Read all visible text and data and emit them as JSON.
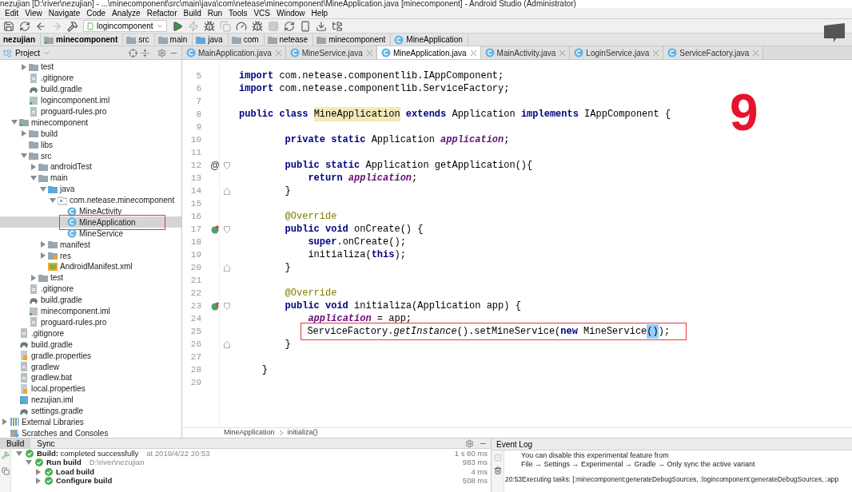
{
  "window": {
    "title": "nezujian [D:\\river\\nezujian] - ...\\minecomponent\\src\\main\\java\\com\\netease\\minecomponent\\MineApplication.java [minecomponent] - Android Studio (Administrator)"
  },
  "menu": [
    "Edit",
    "View",
    "Navigate",
    "Code",
    "Analyze",
    "Refactor",
    "Build",
    "Run",
    "Tools",
    "VCS",
    "Window",
    "Help"
  ],
  "toolbar": {
    "run_config": "logincomponent"
  },
  "breadcrumb": [
    {
      "label": "nezujian",
      "kind": "project"
    },
    {
      "label": "minecomponent",
      "kind": "module"
    },
    {
      "label": "src",
      "kind": "folder"
    },
    {
      "label": "main",
      "kind": "folder"
    },
    {
      "label": "java",
      "kind": "source"
    },
    {
      "label": "com",
      "kind": "folder"
    },
    {
      "label": "netease",
      "kind": "folder"
    },
    {
      "label": "minecomponent",
      "kind": "folder"
    },
    {
      "label": "MineApplication",
      "kind": "class"
    }
  ],
  "project_panel": {
    "title": "Project",
    "tree": {
      "continued": [
        {
          "label": "test",
          "kind": "folder",
          "expanded": false,
          "selected": false,
          "outlined": false
        },
        {
          "label": ".gitignore",
          "kind": "file",
          "selected": false,
          "outlined": false
        },
        {
          "label": "build.gradle",
          "kind": "gradle",
          "selected": false,
          "outlined": false
        },
        {
          "label": "logincomponent.iml",
          "kind": "iml",
          "selected": false,
          "outlined": false
        },
        {
          "label": "proguard-rules.pro",
          "kind": "file",
          "selected": false,
          "outlined": false
        }
      ],
      "items": [
        {
          "label": "minecomponent",
          "kind": "module",
          "expanded": true,
          "selected": false,
          "outlined": false,
          "children": [
            {
              "label": "build",
              "kind": "folder",
              "expanded": false,
              "selected": false,
              "outlined": false
            },
            {
              "label": "libs",
              "kind": "folder",
              "selected": false,
              "outlined": false
            },
            {
              "label": "src",
              "kind": "folder",
              "expanded": true,
              "selected": false,
              "outlined": false,
              "children": [
                {
                  "label": "androidTest",
                  "kind": "folder",
                  "expanded": false,
                  "selected": false,
                  "outlined": false
                },
                {
                  "label": "main",
                  "kind": "folder",
                  "expanded": true,
                  "selected": false,
                  "outlined": false,
                  "children": [
                    {
                      "label": "java",
                      "kind": "source",
                      "expanded": true,
                      "selected": false,
                      "outlined": false,
                      "children": [
                        {
                          "label": "com.netease.minecomponent",
                          "kind": "package",
                          "expanded": true,
                          "selected": false,
                          "outlined": false,
                          "children": [
                            {
                              "label": "MineActivity",
                              "kind": "class",
                              "selected": false,
                              "outlined": false
                            },
                            {
                              "label": "MineApplication",
                              "kind": "class",
                              "selected": true,
                              "outlined": true
                            },
                            {
                              "label": "MineService",
                              "kind": "class",
                              "selected": false,
                              "outlined": false
                            }
                          ]
                        }
                      ]
                    },
                    {
                      "label": "manifest",
                      "kind": "folder",
                      "expanded": false,
                      "selected": false,
                      "outlined": false
                    },
                    {
                      "label": "res",
                      "kind": "res",
                      "expanded": false,
                      "selected": false,
                      "outlined": false
                    },
                    {
                      "label": "AndroidManifest.xml",
                      "kind": "xml",
                      "selected": false,
                      "outlined": false
                    }
                  ]
                },
                {
                  "label": "test",
                  "kind": "folder",
                  "expanded": false,
                  "selected": false,
                  "outlined": false
                }
              ]
            },
            {
              "label": ".gitignore",
              "kind": "file",
              "selected": false,
              "outlined": false
            },
            {
              "label": "build.gradle",
              "kind": "gradle",
              "selected": false,
              "outlined": false
            },
            {
              "label": "minecomponent.iml",
              "kind": "iml",
              "selected": false,
              "outlined": false
            },
            {
              "label": "proguard-rules.pro",
              "kind": "file",
              "selected": false,
              "outlined": false
            }
          ]
        },
        {
          "label": ".gitignore",
          "kind": "file",
          "selected": false,
          "outlined": false
        },
        {
          "label": "build.gradle",
          "kind": "gradle",
          "selected": false,
          "outlined": false
        },
        {
          "label": "gradle.properties",
          "kind": "properties",
          "selected": false,
          "outlined": false
        },
        {
          "label": "gradlew",
          "kind": "file",
          "selected": false,
          "outlined": false
        },
        {
          "label": "gradlew.bat",
          "kind": "file",
          "selected": false,
          "outlined": false
        },
        {
          "label": "local.properties",
          "kind": "properties",
          "selected": false,
          "outlined": false
        },
        {
          "label": "nezujian.iml",
          "kind": "projiml",
          "selected": false,
          "outlined": false
        },
        {
          "label": "settings.gradle",
          "kind": "gradle",
          "selected": false,
          "outlined": false
        }
      ],
      "roots": [
        {
          "label": "External Libraries",
          "kind": "libraries",
          "expanded": false,
          "selected": false,
          "outlined": false
        },
        {
          "label": "Scratches and Consoles",
          "kind": "scratches",
          "selected": false,
          "outlined": false
        }
      ]
    }
  },
  "editor_tabs": [
    {
      "label": "MainApplication.java",
      "selected": false
    },
    {
      "label": "MineService.java",
      "selected": false
    },
    {
      "label": "MineApplication.java",
      "selected": true
    },
    {
      "label": "MainActivity.java",
      "selected": false
    },
    {
      "label": "LoginService.java",
      "selected": false
    },
    {
      "label": "ServiceFactory.java",
      "selected": false
    }
  ],
  "code": [
    {
      "number": "5",
      "outlined": false,
      "tokens": [
        {
          "t": "import",
          "kind": "kw"
        },
        {
          "t": " com.netease.componentlib.IAppComponent;",
          "kind": "plain"
        }
      ]
    },
    {
      "number": "6",
      "outlined": false,
      "tokens": [
        {
          "t": "import",
          "kind": "kw"
        },
        {
          "t": " com.netease.componentlib.ServiceFactory;",
          "kind": "plain"
        }
      ]
    },
    {
      "number": "7",
      "outlined": false
    },
    {
      "number": "8",
      "outlined": false,
      "tokens": [
        {
          "t": "public class ",
          "kind": "kw"
        },
        {
          "t": "MineApplication",
          "kind": "usage"
        },
        {
          "t": " extends",
          "kind": "kw"
        },
        {
          "t": " Application ",
          "kind": "plain"
        },
        {
          "t": "implements",
          "kind": "kw"
        },
        {
          "t": " IAppComponent {",
          "kind": "plain"
        }
      ]
    },
    {
      "number": "9",
      "outlined": false
    },
    {
      "number": "10",
      "outlined": false,
      "tokens": [
        {
          "t": "        private static",
          "kind": "kw"
        },
        {
          "t": " Application ",
          "kind": "plain"
        },
        {
          "t": "application",
          "kind": "field"
        },
        {
          "t": ";",
          "kind": "plain"
        }
      ]
    },
    {
      "number": "11",
      "outlined": false
    },
    {
      "number": "12",
      "outlined": false,
      "gutter": [
        {
          "kind": "at",
          "text": "@"
        },
        {
          "kind": "fold_start"
        }
      ],
      "tokens": [
        {
          "t": "        public static",
          "kind": "kw"
        },
        {
          "t": " Application getApplication(){",
          "kind": "plain"
        }
      ]
    },
    {
      "number": "13",
      "outlined": false,
      "tokens": [
        {
          "t": "            return ",
          "kind": "kw"
        },
        {
          "t": "application",
          "kind": "field"
        },
        {
          "t": ";",
          "kind": "plain"
        }
      ]
    },
    {
      "number": "14",
      "outlined": false,
      "gutter": [
        {
          "kind": "fold_end"
        }
      ],
      "tokens": [
        {
          "t": "        }",
          "kind": "plain"
        }
      ]
    },
    {
      "number": "15",
      "outlined": false
    },
    {
      "number": "16",
      "outlined": false,
      "tokens": [
        {
          "t": "        @Override",
          "kind": "annotation"
        }
      ]
    },
    {
      "number": "17",
      "outlined": false,
      "gutter": [
        {
          "kind": "override"
        },
        {
          "kind": "fold_start"
        }
      ],
      "tokens": [
        {
          "t": "        public void",
          "kind": "kw"
        },
        {
          "t": " onCreate() {",
          "kind": "plain"
        }
      ]
    },
    {
      "number": "18",
      "outlined": false,
      "tokens": [
        {
          "t": "            super",
          "kind": "kw"
        },
        {
          "t": ".onCreate();",
          "kind": "plain"
        }
      ]
    },
    {
      "number": "19",
      "outlined": false,
      "tokens": [
        {
          "t": "            initializa(",
          "kind": "plain"
        },
        {
          "t": "this",
          "kind": "kw"
        },
        {
          "t": ");",
          "kind": "plain"
        }
      ]
    },
    {
      "number": "20",
      "outlined": false,
      "gutter": [
        {
          "kind": "fold_end"
        }
      ],
      "tokens": [
        {
          "t": "        }",
          "kind": "plain"
        }
      ]
    },
    {
      "number": "21",
      "outlined": false
    },
    {
      "number": "22",
      "outlined": false,
      "tokens": [
        {
          "t": "        @Override",
          "kind": "annotation"
        }
      ]
    },
    {
      "number": "23",
      "outlined": false,
      "gutter": [
        {
          "kind": "override"
        },
        {
          "kind": "fold_start"
        }
      ],
      "tokens": [
        {
          "t": "        public void",
          "kind": "kw"
        },
        {
          "t": " initializa(Application app) {",
          "kind": "plain"
        }
      ]
    },
    {
      "number": "24",
      "outlined": false,
      "tokens": [
        {
          "t": "            application",
          "kind": "field"
        },
        {
          "t": " = app;",
          "kind": "plain"
        }
      ]
    },
    {
      "number": "25",
      "outlined": true,
      "tokens": [
        {
          "t": "            ServiceFactory.",
          "kind": "plain"
        },
        {
          "t": "getInstance",
          "kind": "static"
        },
        {
          "t": "().setMineService(",
          "kind": "plain"
        },
        {
          "t": "new",
          "kind": "kw"
        },
        {
          "t": " MineService",
          "kind": "plain"
        },
        {
          "t": "()",
          "kind": "match"
        },
        {
          "t": ");",
          "kind": "plain"
        }
      ]
    },
    {
      "number": "26",
      "outlined": false,
      "gutter": [
        {
          "kind": "fold_end"
        }
      ],
      "tokens": [
        {
          "t": "        }",
          "kind": "plain"
        }
      ]
    },
    {
      "number": "27",
      "outlined": false
    },
    {
      "number": "28",
      "outlined": false,
      "tokens": [
        {
          "t": "    }",
          "kind": "plain"
        }
      ]
    },
    {
      "number": "29",
      "outlined": false
    }
  ],
  "handwritten_note": "9",
  "editor_breadcrumb": [
    "MineApplication",
    "initializa()"
  ],
  "build_panel": {
    "tabs": [
      {
        "label": "Build",
        "selected": true
      },
      {
        "label": "Sync",
        "selected": false
      }
    ],
    "rows": [
      {
        "bold": "Build:",
        "text": "completed successfully",
        "note": "at 2019/4/22 20:53",
        "time": "1 s 80 ms",
        "expanded": true,
        "children": [
          {
            "bold": "Run build",
            "note": "D:\\river\\nezujian",
            "time": "983 ms",
            "expanded": true,
            "children": [
              {
                "bold": "Load build",
                "time": "4 ms",
                "expanded": false
              },
              {
                "bold": "Configure build",
                "time": "508 ms",
                "expanded": false
              }
            ]
          }
        ]
      }
    ]
  },
  "event_log": {
    "title": "Event Log",
    "lines": [
      {
        "kind": "message",
        "text": "You can disable this experimental feature from"
      },
      {
        "kind": "message",
        "text": "File → Settings → Experimental → Gradle → Only sync the active variant"
      },
      {
        "kind": "gap"
      },
      {
        "kind": "entry",
        "time": "20:53",
        "text": "Executing tasks: [:minecomponent:generateDebugSources, :logincomponent:generateDebugSources, :app"
      }
    ]
  }
}
